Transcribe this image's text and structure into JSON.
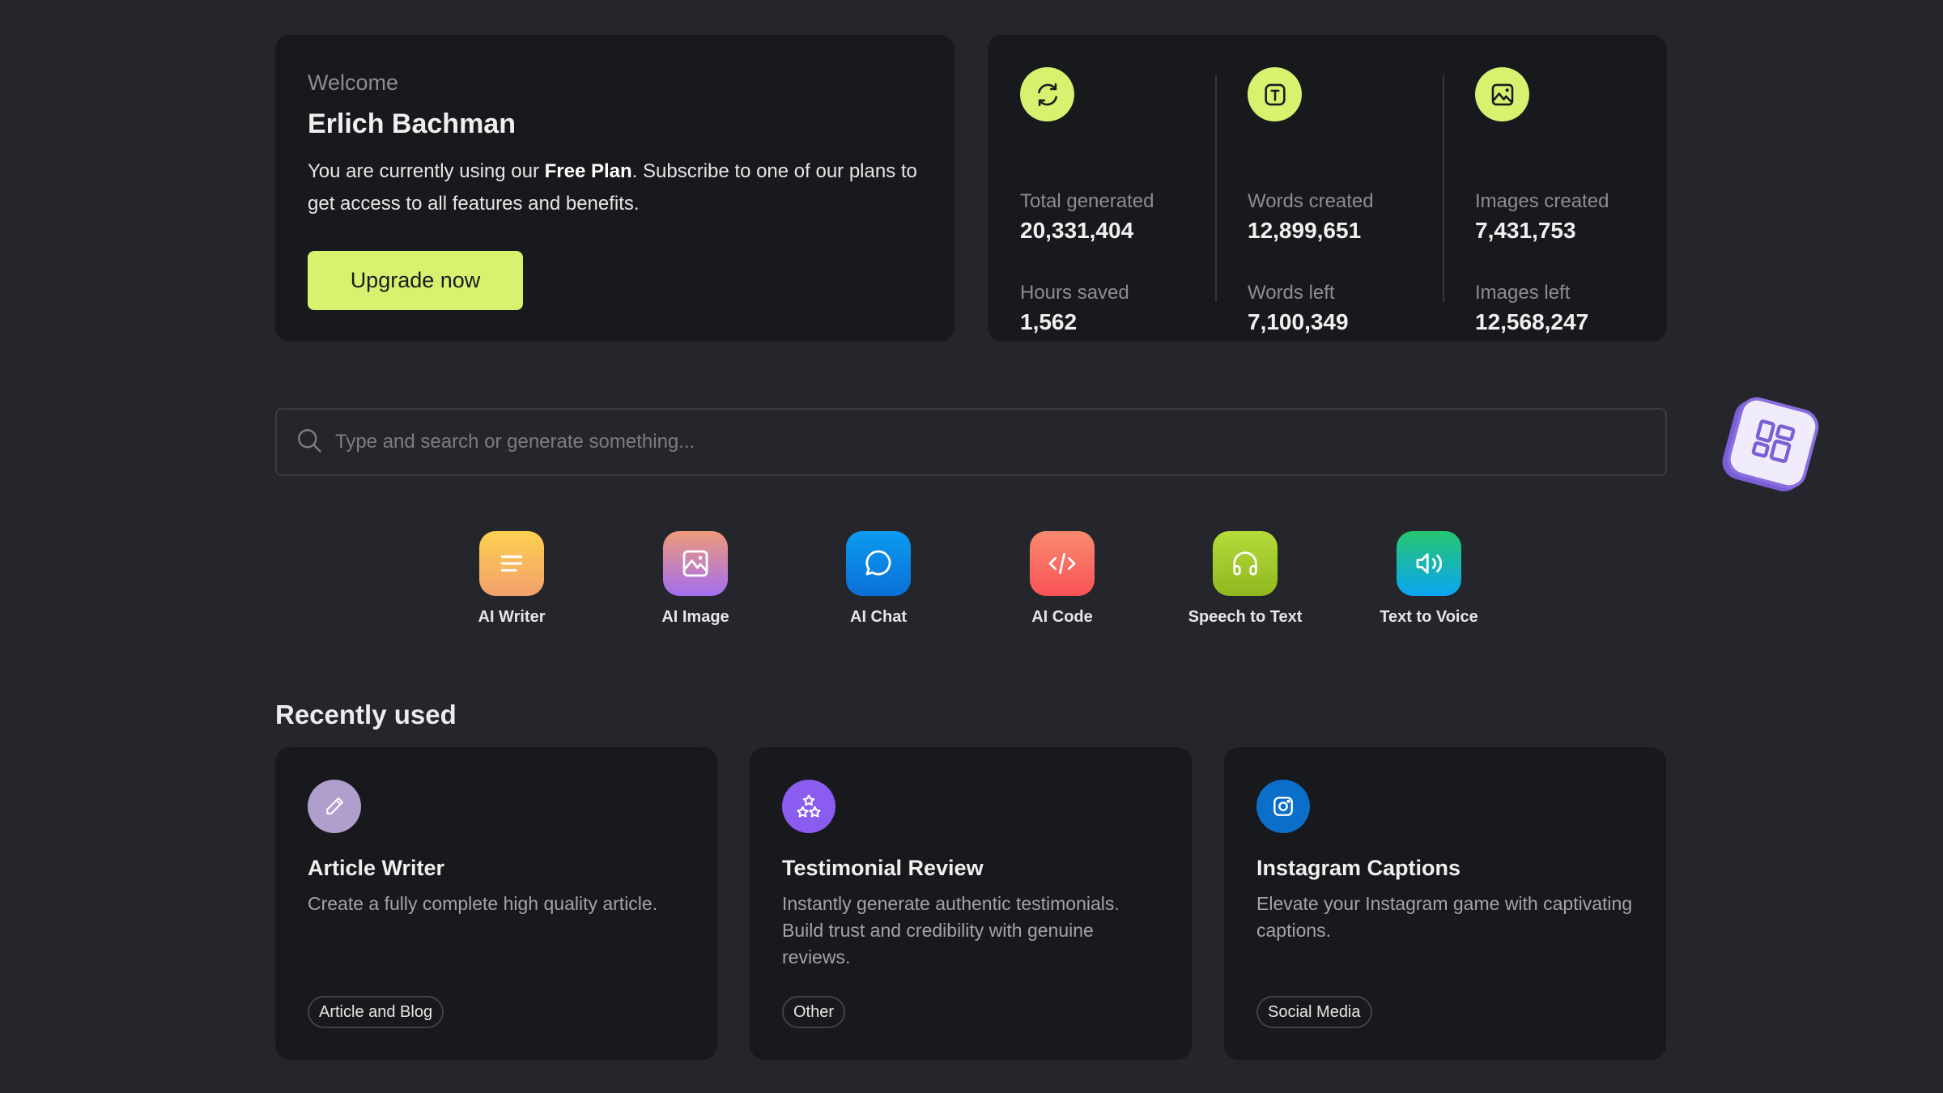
{
  "welcome": {
    "label": "Welcome",
    "user_name": "Erlich Bachman",
    "plan_prefix": "You are currently using our ",
    "plan_name": "Free Plan",
    "plan_suffix": ". Subscribe to one of our plans to get access to all features and benefits.",
    "upgrade_button": "Upgrade now"
  },
  "stats": {
    "columns": [
      {
        "icon": "refresh-icon",
        "items": [
          {
            "label": "Total generated",
            "value": "20,331,404"
          },
          {
            "label": "Hours saved",
            "value": "1,562"
          }
        ]
      },
      {
        "icon": "text-icon",
        "items": [
          {
            "label": "Words created",
            "value": "12,899,651"
          },
          {
            "label": "Words left",
            "value": "7,100,349"
          }
        ]
      },
      {
        "icon": "image-icon",
        "items": [
          {
            "label": "Images created",
            "value": "7,431,753"
          },
          {
            "label": "Images left",
            "value": "12,568,247"
          }
        ]
      }
    ],
    "accent_color": "#d6f26e"
  },
  "search": {
    "placeholder": "Type and search or generate something...",
    "value": ""
  },
  "floating_widget": {
    "icon": "grid-icon"
  },
  "tools": [
    {
      "label": "AI Writer",
      "icon": "lines-icon",
      "gradient": [
        "#fdd14f",
        "#f3a06e"
      ]
    },
    {
      "label": "AI Image",
      "icon": "image-icon",
      "gradient": [
        "#ef9a7a",
        "#a36ef0"
      ]
    },
    {
      "label": "AI Chat",
      "icon": "chat-bubble-icon",
      "gradient": [
        "#0b9bf0",
        "#0b6fd6"
      ]
    },
    {
      "label": "AI Code",
      "icon": "code-icon",
      "gradient": [
        "#f78a6f",
        "#fb5357"
      ]
    },
    {
      "label": "Speech to Text",
      "icon": "headphones-icon",
      "gradient": [
        "#b6dc3a",
        "#8fb820"
      ]
    },
    {
      "label": "Text to Voice",
      "icon": "speaker-icon",
      "gradient": [
        "#27c66f",
        "#0aa6f3"
      ]
    }
  ],
  "recent": {
    "title": "Recently used",
    "cards": [
      {
        "title": "Article Writer",
        "description": "Create a fully complete high quality article.",
        "tag": "Article and Blog",
        "icon": "pencil-icon",
        "icon_color": "#b09fcd"
      },
      {
        "title": "Testimonial Review",
        "description": "Instantly generate authentic testimonials. Build trust and credibility with genuine reviews.",
        "tag": "Other",
        "icon": "stars-icon",
        "icon_color": "#8a5cf0"
      },
      {
        "title": "Instagram Captions",
        "description": "Elevate your Instagram game with captivating captions.",
        "tag": "Social Media",
        "icon": "instagram-icon",
        "icon_color": "#0a6fc9"
      }
    ]
  }
}
